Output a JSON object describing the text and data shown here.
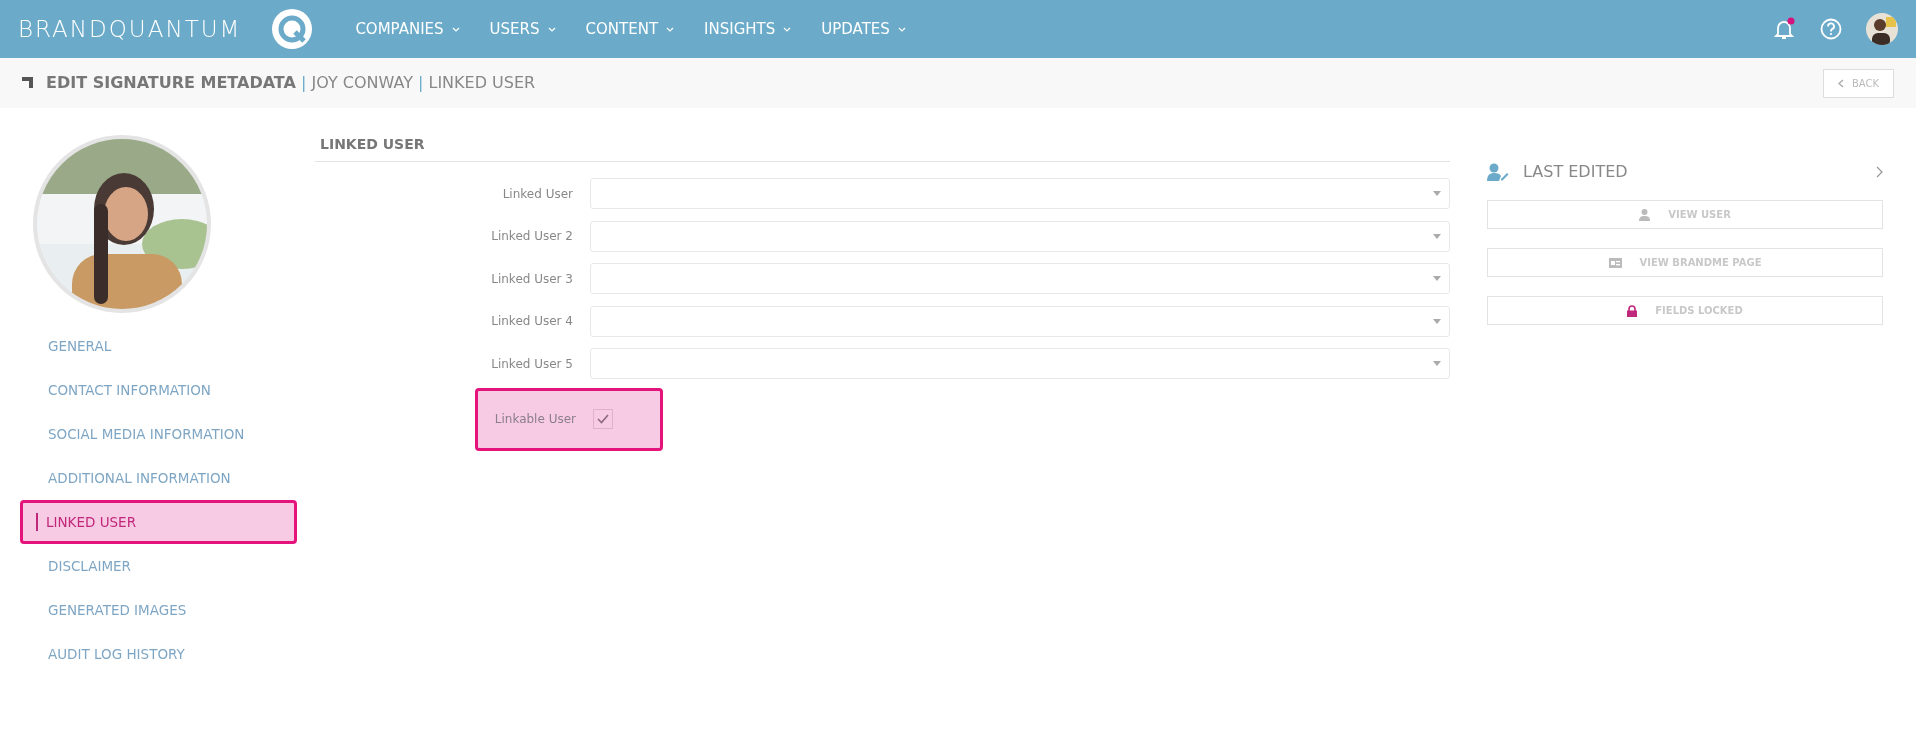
{
  "navbar": {
    "brand": "BRANDQUANTUM",
    "menu": [
      {
        "label": "COMPANIES"
      },
      {
        "label": "USERS"
      },
      {
        "label": "CONTENT"
      },
      {
        "label": "INSIGHTS"
      },
      {
        "label": "UPDATES"
      }
    ],
    "notification_unread": true
  },
  "breadcrumb": {
    "title": "EDIT SIGNATURE METADATA",
    "separator": "|",
    "parts": [
      "JOY CONWAY",
      "LINKED USER"
    ],
    "back": "BACK"
  },
  "sidebar": {
    "items": [
      {
        "label": "GENERAL",
        "selected": false
      },
      {
        "label": "CONTACT INFORMATION",
        "selected": false
      },
      {
        "label": "SOCIAL MEDIA INFORMATION",
        "selected": false
      },
      {
        "label": "ADDITIONAL INFORMATION",
        "selected": false
      },
      {
        "label": "LINKED USER",
        "selected": true
      },
      {
        "label": "DISCLAIMER",
        "selected": false
      },
      {
        "label": "GENERATED IMAGES",
        "selected": false
      },
      {
        "label": "AUDIT LOG HISTORY",
        "selected": false
      }
    ]
  },
  "form": {
    "title": "LINKED USER",
    "fields": [
      {
        "kind": "select",
        "label": "Linked User"
      },
      {
        "kind": "select",
        "label": "Linked User 2"
      },
      {
        "kind": "select",
        "label": "Linked User 3"
      },
      {
        "kind": "select",
        "label": "Linked User 4"
      },
      {
        "kind": "select",
        "label": "Linked User 5"
      },
      {
        "kind": "checkbox",
        "label": "Linkable User",
        "checked": true,
        "highlighted": true
      }
    ]
  },
  "side_panel": {
    "title": "LAST EDITED",
    "buttons": [
      {
        "kind": "user",
        "label": "VIEW USER"
      },
      {
        "kind": "card",
        "label": "VIEW BRANDME PAGE"
      },
      {
        "kind": "lock",
        "label": "FIELDS LOCKED"
      }
    ]
  }
}
